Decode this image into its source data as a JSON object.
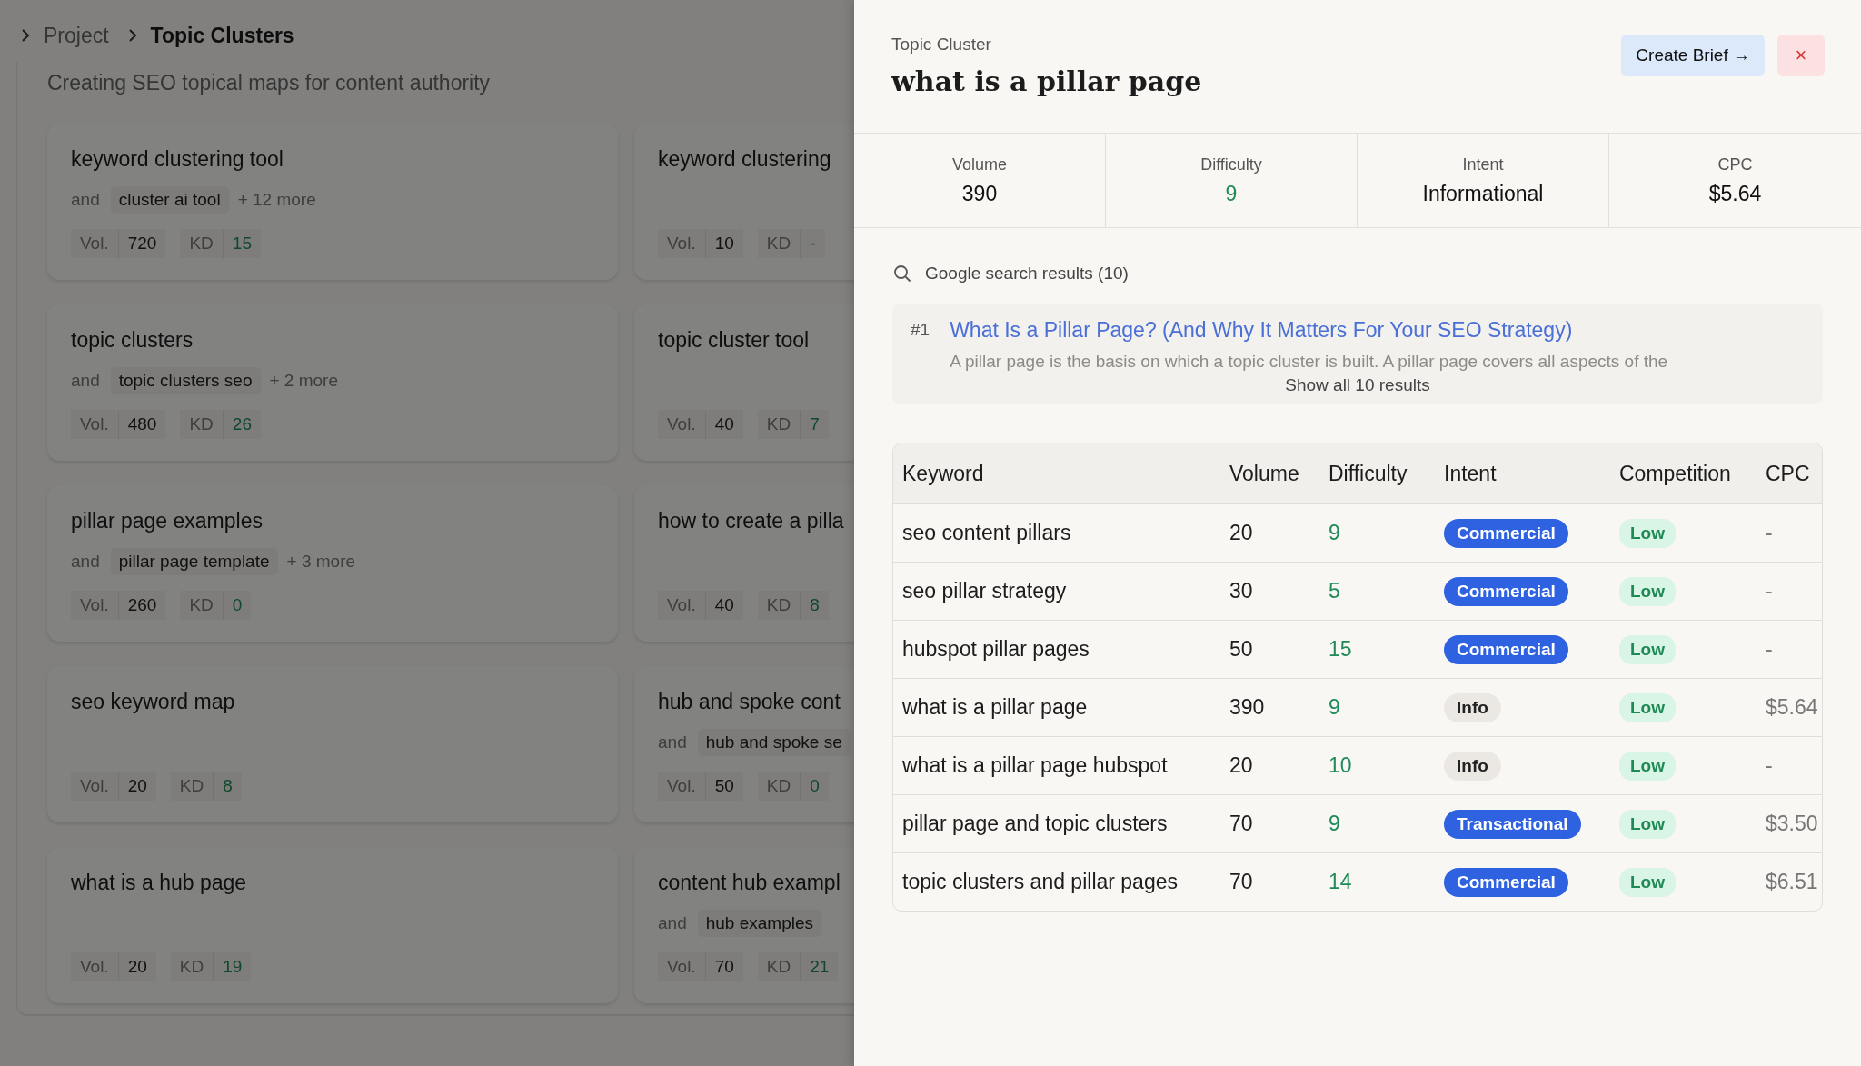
{
  "breadcrumb": [
    {
      "label": "Project",
      "current": false
    },
    {
      "label": "Topic Clusters",
      "current": true
    }
  ],
  "subtitle": "Creating SEO topical maps for content authority",
  "clusters": [
    {
      "title": "keyword clustering tool",
      "and": "and",
      "keyword": "cluster ai tool",
      "more": "+ 12 more",
      "vol_label": "Vol.",
      "vol": "720",
      "kd_label": "KD",
      "kd": "15"
    },
    {
      "title": "keyword clustering",
      "vol_label": "Vol.",
      "vol": "10",
      "kd_label": "KD",
      "kd": "-"
    },
    {
      "title": "topic clusters",
      "and": "and",
      "keyword": "topic clusters seo",
      "more": "+ 2 more",
      "vol_label": "Vol.",
      "vol": "480",
      "kd_label": "KD",
      "kd": "26"
    },
    {
      "title": "topic cluster tool",
      "vol_label": "Vol.",
      "vol": "40",
      "kd_label": "KD",
      "kd": "7"
    },
    {
      "title": "pillar page examples",
      "and": "and",
      "keyword": "pillar page template",
      "more": "+ 3 more",
      "vol_label": "Vol.",
      "vol": "260",
      "kd_label": "KD",
      "kd": "0"
    },
    {
      "title": "how to create a pilla",
      "vol_label": "Vol.",
      "vol": "40",
      "kd_label": "KD",
      "kd": "8"
    },
    {
      "title": "seo keyword map",
      "vol_label": "Vol.",
      "vol": "20",
      "kd_label": "KD",
      "kd": "8"
    },
    {
      "title": "hub and spoke cont",
      "and": "and",
      "keyword": "hub and spoke se",
      "vol_label": "Vol.",
      "vol": "50",
      "kd_label": "KD",
      "kd": "0"
    },
    {
      "title": "what is a hub page",
      "vol_label": "Vol.",
      "vol": "20",
      "kd_label": "KD",
      "kd": "19"
    },
    {
      "title": "content hub exampl",
      "and": "and",
      "keyword": "hub examples",
      "vol_label": "Vol.",
      "vol": "70",
      "kd_label": "KD",
      "kd": "21"
    }
  ],
  "drawer": {
    "eyebrow": "Topic Cluster",
    "title": "what is a pillar page",
    "create_button": "Create Brief →",
    "close_button": "×",
    "stats": [
      {
        "label": "Volume",
        "value": "390",
        "kind": "plain"
      },
      {
        "label": "Difficulty",
        "value": "9",
        "kind": "score"
      },
      {
        "label": "Intent",
        "value": "Informational",
        "kind": "plain"
      },
      {
        "label": "CPC",
        "value": "$5.64",
        "kind": "plain"
      }
    ],
    "search_label": "Google search results (10)",
    "results": [
      {
        "rank": "#1",
        "title": "What Is a Pillar Page? (And Why It Matters For Your SEO Strategy)",
        "snippet": "A pillar page is the basis on which a topic cluster is built. A pillar page covers all aspects of the"
      }
    ],
    "show_all": "Show all 10 results",
    "table": {
      "columns": [
        "Keyword",
        "Volume",
        "Difficulty",
        "Intent",
        "Competition",
        "CPC"
      ],
      "rows": [
        {
          "keyword": "seo content pillars",
          "volume": "20",
          "difficulty": "9",
          "intent": {
            "label": "Commercial",
            "color": "#2f62e0"
          },
          "competition": "Low",
          "cpc": "-"
        },
        {
          "keyword": "seo pillar strategy",
          "volume": "30",
          "difficulty": "5",
          "intent": {
            "label": "Commercial",
            "color": "#2f62e0"
          },
          "competition": "Low",
          "cpc": "-"
        },
        {
          "keyword": "hubspot pillar pages",
          "volume": "50",
          "difficulty": "15",
          "intent": {
            "label": "Commercial",
            "color": "#2f62e0"
          },
          "competition": "Low",
          "cpc": "-"
        },
        {
          "keyword": "what is a pillar page",
          "volume": "390",
          "difficulty": "9",
          "intent": {
            "label": "Info",
            "color": "#ebe8e3"
          },
          "competition": "Low",
          "cpc": "$5.64"
        },
        {
          "keyword": "what is a pillar page hubspot",
          "volume": "20",
          "difficulty": "10",
          "intent": {
            "label": "Info",
            "color": "#ebe8e3"
          },
          "competition": "Low",
          "cpc": "-"
        },
        {
          "keyword": "pillar page and topic clusters",
          "volume": "70",
          "difficulty": "9",
          "intent": {
            "label": "Transactional",
            "color": "#2f62e0"
          },
          "competition": "Low",
          "cpc": "$3.50"
        },
        {
          "keyword": "topic clusters and pillar pages",
          "volume": "70",
          "difficulty": "14",
          "intent": {
            "label": "Commercial",
            "color": "#2f62e0"
          },
          "competition": "Low",
          "cpc": "$6.51"
        }
      ]
    }
  }
}
